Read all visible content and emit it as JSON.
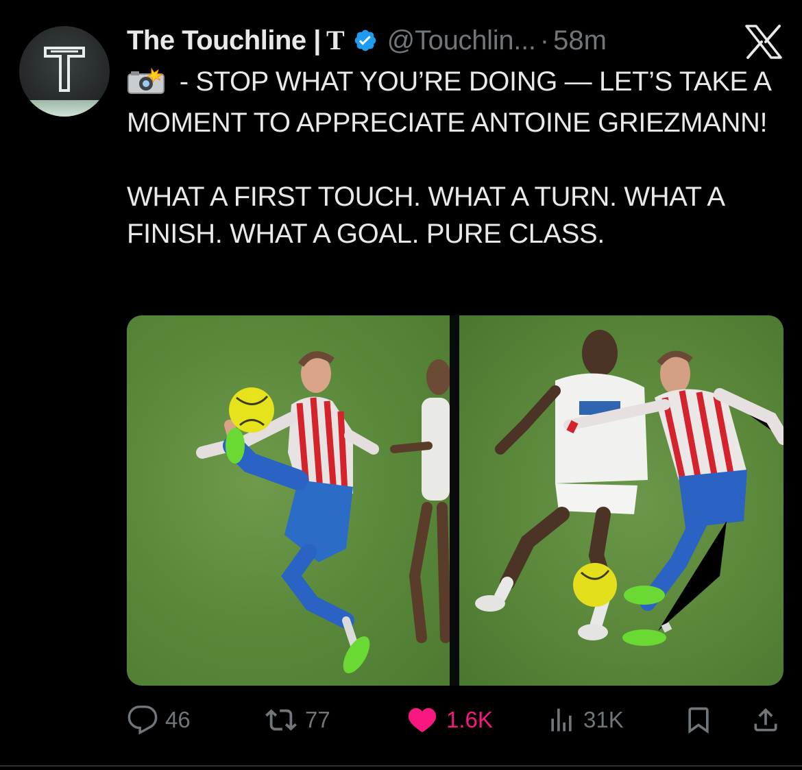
{
  "author": {
    "display_name": "The Touchline |",
    "name_suffix": "T",
    "handle": "@Touchlin...",
    "separator": "·",
    "time_ago": "58m",
    "avatar_letter": "T"
  },
  "tweet": {
    "line1": " - STOP WHAT YOU’RE DOING — LET’S TAKE A MOMENT TO APPRECIATE ANTOINE GRIEZMANN!",
    "line2": "WHAT A FIRST TOUCH. WHAT A TURN. WHAT A FINISH. WHAT A GOAL. PURE CLASS."
  },
  "actions": {
    "replies": "46",
    "reposts": "77",
    "likes": "1.6K",
    "views": "31K"
  },
  "colors": {
    "background": "#000000",
    "text": "#e7e9ea",
    "muted": "#71767b",
    "verified": "#1d9bf0",
    "like": "#f91880"
  },
  "icons": {
    "camera": "camera-flash-icon",
    "verified": "verified-badge-icon",
    "brand": "x-logo-icon",
    "reply": "reply-icon",
    "repost": "repost-icon",
    "like": "heart-icon",
    "views": "views-icon",
    "bookmark": "bookmark-icon",
    "share": "share-icon"
  }
}
